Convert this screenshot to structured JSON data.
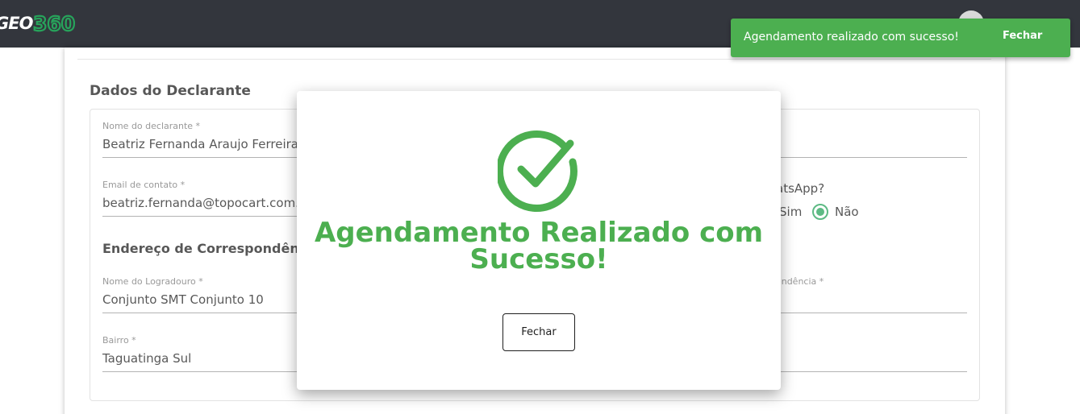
{
  "app": {
    "logo_text": "GEO",
    "logo_numbers": "360"
  },
  "form": {
    "section_title": "Dados do Declarante",
    "declarante": {
      "name_label": "Nome do declarante *",
      "name_value": "Beatriz Fernanda Araujo Ferreira",
      "email_label": "Email de contato *",
      "email_value": "beatriz.fernanda@topocart.com.br"
    },
    "whatsapp": {
      "question": "atsApp?",
      "option_yes": "Sim",
      "option_no": "Não",
      "selected": "Não"
    },
    "endereco": {
      "subtitle": "Endereço de Correspondência",
      "logradouro_label": "Nome do Logradouro *",
      "logradouro_value": "Conjunto SMT Conjunto 10",
      "complemento_label": "ondência *",
      "bairro_label": "Bairro *",
      "bairro_value": "Taguatinga Sul"
    }
  },
  "modal": {
    "title": "Agendamento Realizado com Sucesso!",
    "button_label": "Fechar",
    "accent_color": "#4caf50",
    "icon": "check-circle-icon"
  },
  "toast": {
    "message": "Agendamento realizado com sucesso!",
    "button_label": "Fechar",
    "background_color": "#4caf50"
  }
}
